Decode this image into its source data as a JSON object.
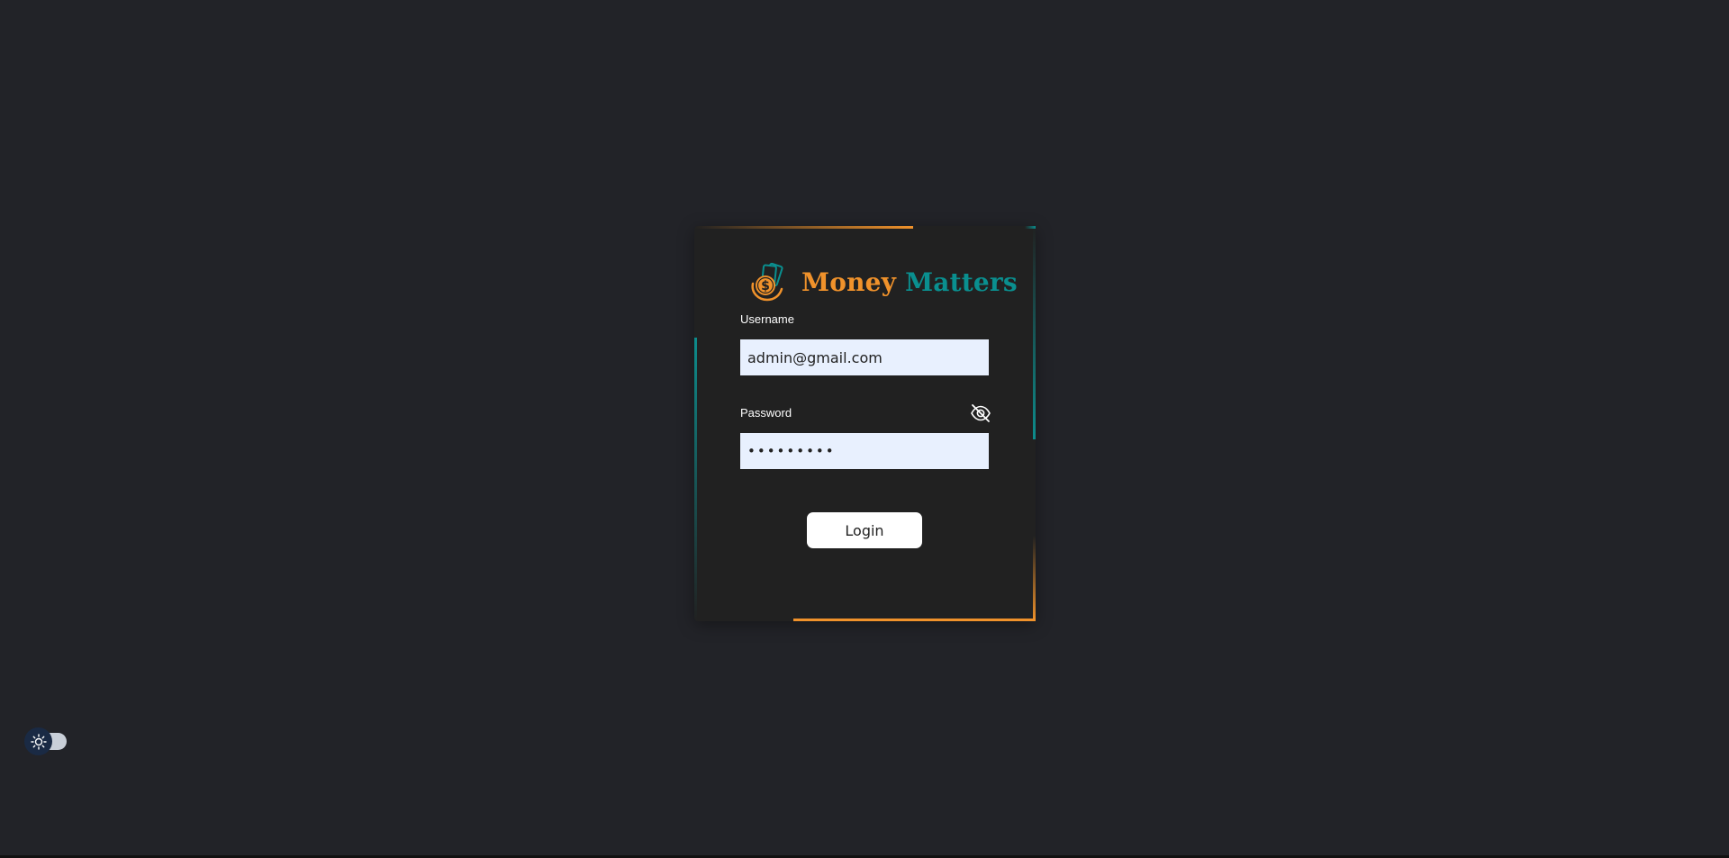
{
  "brand": {
    "name_part1": "Money",
    "name_part2": "Matters",
    "logo_icon": "dollar-coin-icon"
  },
  "form": {
    "username_label": "Username",
    "username_value": "admin@gmail.com",
    "password_label": "Password",
    "password_value": "•••••••••",
    "password_toggle_icon": "eye-slash-icon",
    "login_label": "Login"
  },
  "theme_toggle": {
    "icon": "sun-icon",
    "state": "off"
  },
  "colors": {
    "background": "#222328",
    "card": "#212121",
    "accent_orange": "#f0922b",
    "accent_teal": "#0a8f8f",
    "input_bg": "#e8f0fe"
  }
}
